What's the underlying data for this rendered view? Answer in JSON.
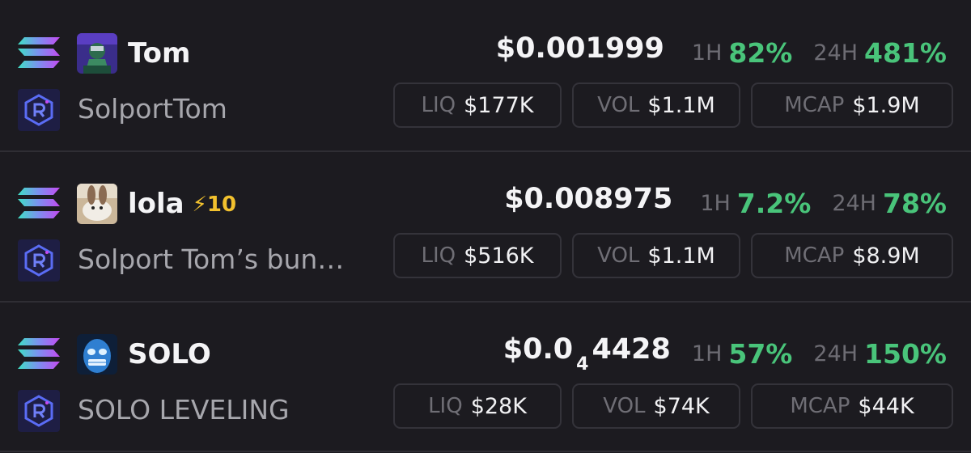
{
  "tokens": [
    {
      "symbol": "Tom",
      "name": "SolportTom",
      "boost": "",
      "price_main": "$0.001999",
      "price_zeros": "",
      "price_tail": "",
      "h1_label": "1H",
      "h1_pct": "82%",
      "h24_label": "24H",
      "h24_pct": "481%",
      "liq_label": "LIQ",
      "liq": "$177K",
      "vol_label": "VOL",
      "vol": "$1.1M",
      "mcap_label": "MCAP",
      "mcap": "$1.9M",
      "chain_icon": "solana-icon",
      "dex_icon": "raydium-icon"
    },
    {
      "symbol": "lola",
      "name": "Solport Tom’s bun…",
      "boost": "⚡10",
      "price_main": "$0.008975",
      "price_zeros": "",
      "price_tail": "",
      "h1_label": "1H",
      "h1_pct": "7.2%",
      "h24_label": "24H",
      "h24_pct": "78%",
      "liq_label": "LIQ",
      "liq": "$516K",
      "vol_label": "VOL",
      "vol": "$1.1M",
      "mcap_label": "MCAP",
      "mcap": "$8.9M",
      "chain_icon": "solana-icon",
      "dex_icon": "raydium-icon"
    },
    {
      "symbol": "SOLO",
      "name": "SOLO LEVELING",
      "boost": "",
      "price_main": "$0.0",
      "price_zeros": "4",
      "price_tail": "4428",
      "h1_label": "1H",
      "h1_pct": "57%",
      "h24_label": "24H",
      "h24_pct": "150%",
      "liq_label": "LIQ",
      "liq": "$28K",
      "vol_label": "VOL",
      "vol": "$74K",
      "mcap_label": "MCAP",
      "mcap": "$44K",
      "chain_icon": "solana-icon",
      "dex_icon": "raydium-icon"
    }
  ],
  "colors": {
    "background": "#1c1b20",
    "positive": "#49c47a",
    "boost": "#f2c12e",
    "muted": "#6d6c73"
  }
}
